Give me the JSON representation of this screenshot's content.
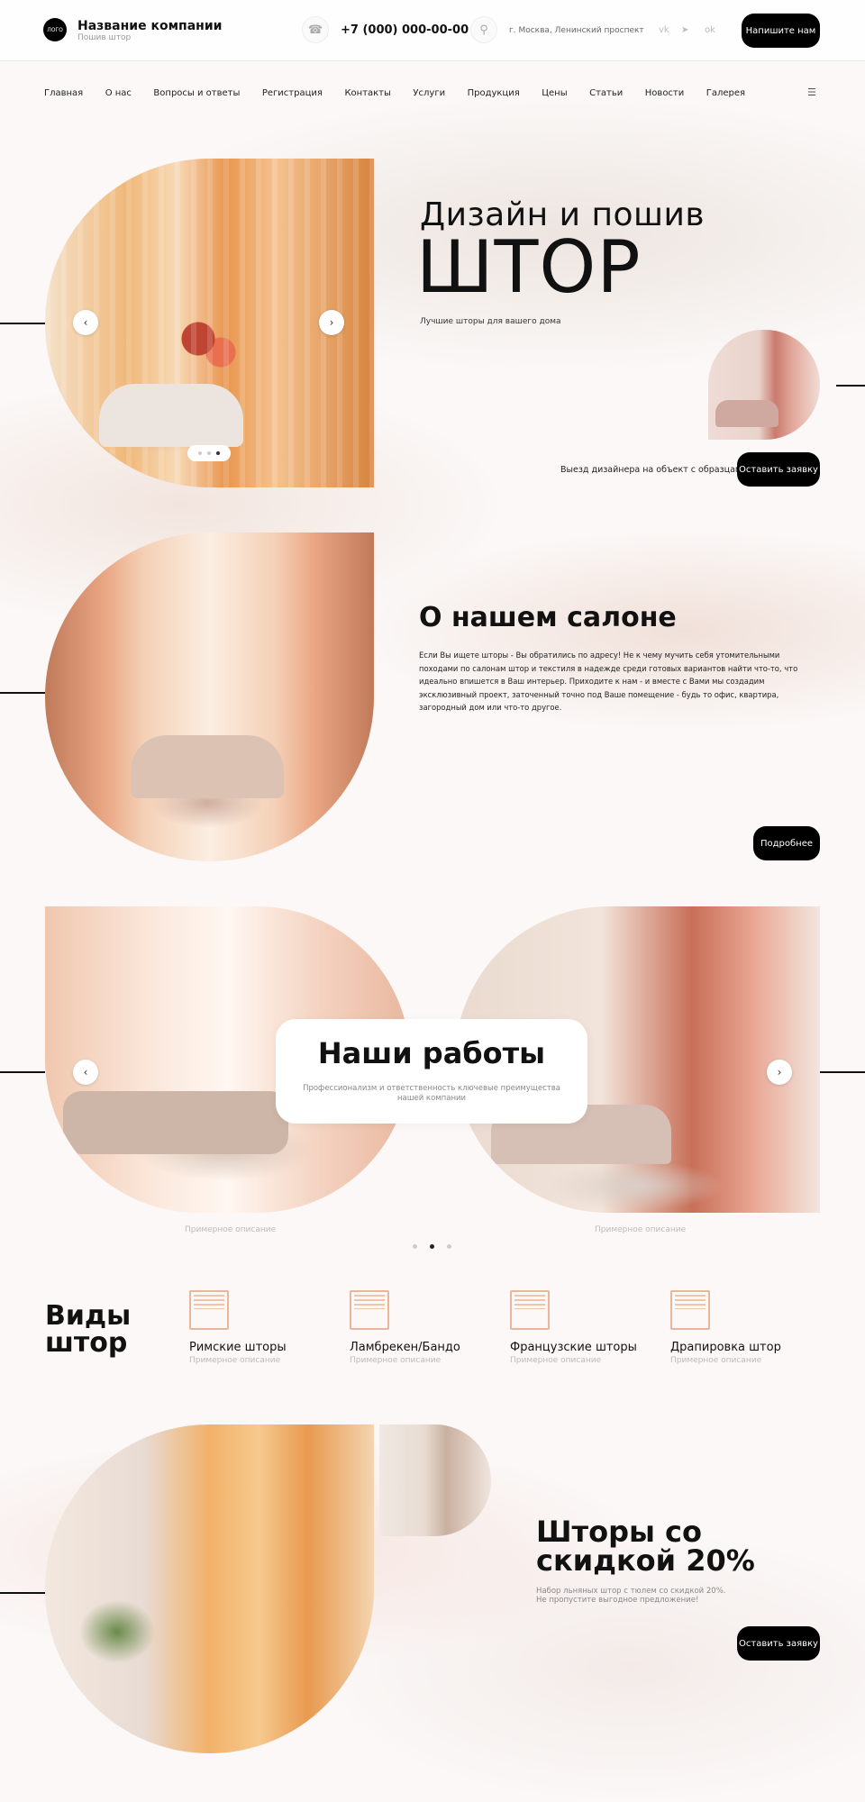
{
  "header": {
    "logo_text": "ЛОГО",
    "company_name": "Название компании",
    "tagline": "Пошив штор",
    "phone": "+7 (000) 000-00-00",
    "address": "г. Москва, Ленинский проспект",
    "write_us_button": "Напишите нам"
  },
  "nav": {
    "items": [
      "Главная",
      "О нас",
      "Вопросы и ответы",
      "Регистрация",
      "Контакты",
      "Услуги",
      "Продукция",
      "Цены",
      "Статьи",
      "Новости",
      "Галерея"
    ]
  },
  "hero": {
    "title_line1": "Дизайн и пошив",
    "title_line2": "ШТОР",
    "subtitle": "Лучшие шторы для вашего дома",
    "visit_text": "Выезд дизайнера на объект с образцами",
    "cta_button": "Оставить заявку",
    "slider": {
      "total": 3,
      "active": 3
    }
  },
  "about": {
    "title": "О нашем салоне",
    "text": "Если Вы ищете шторы - Вы обратились по адресу! Не к чему мучить себя утомительными походами по салонам штор и текстиля в надежде среди готовых вариантов найти что-то, что идеально впишется в Ваш интерьер. Приходите к нам - и вместе с Вами мы создадим эксклюзивный проект, заточенный точно под Ваше помещение - будь то офис, квартира, загородный дом или что-то другое.",
    "more_button": "Подробнее"
  },
  "works": {
    "title": "Наши работы",
    "subtitle": "Профессионализм и ответственность ключевые преимущества нашей компании",
    "captions": [
      "Примерное описание",
      "Примерное описание"
    ],
    "pager": {
      "total": 3,
      "active": 2
    }
  },
  "kinds": {
    "title": "Виды штор",
    "items": [
      {
        "name": "Римские шторы",
        "desc": "Примерное описание"
      },
      {
        "name": "Ламбрекен/Бандо",
        "desc": "Примерное описание"
      },
      {
        "name": "Французские шторы",
        "desc": "Примерное описание"
      },
      {
        "name": "Драпировка штор",
        "desc": "Примерное описание"
      }
    ]
  },
  "sale": {
    "title": "Шторы со скидкой 20%",
    "text_line1": "Набор льняных штор с тюлем со скидкой 20%.",
    "text_line2": "Не пропустите выгодное предложение!",
    "cta_button": "Оставить заявку"
  },
  "icons": {
    "phone": "phone-icon",
    "location": "location-pin-icon",
    "social": [
      "vk-icon",
      "telegram-icon",
      "odnoklassniki-icon"
    ],
    "menu": "hamburger-menu-icon"
  }
}
